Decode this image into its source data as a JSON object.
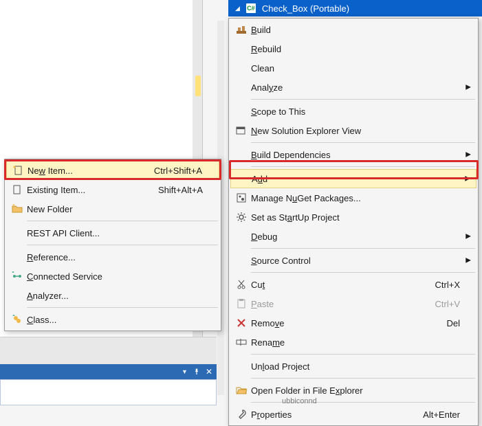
{
  "project": {
    "name": "Check_Box (Portable)"
  },
  "main_menu": {
    "build": {
      "label": "Build",
      "u": 0
    },
    "rebuild": {
      "label": "Rebuild",
      "u": 0
    },
    "clean": {
      "label": "Clean",
      "u": -1
    },
    "analyze": {
      "label": "Analyze",
      "u": 4
    },
    "scope": {
      "label": "Scope to This",
      "u": 0
    },
    "new_view": {
      "label": "New Solution Explorer View",
      "u": 0
    },
    "build_deps": {
      "label": "Build Dependencies",
      "u": 0
    },
    "add": {
      "label": "Add",
      "u": 1
    },
    "nuget": {
      "label": "Manage NuGet Packages...",
      "u": 8
    },
    "startup": {
      "label": "Set as StartUp Project",
      "u": 10
    },
    "debug": {
      "label": "Debug",
      "u": 0
    },
    "source_control": {
      "label": "Source Control",
      "u": 0
    },
    "cut": {
      "label": "Cut",
      "u": 2,
      "shortcut": "Ctrl+X"
    },
    "paste": {
      "label": "Paste",
      "u": 0,
      "shortcut": "Ctrl+V"
    },
    "remove": {
      "label": "Remove",
      "u": 4,
      "shortcut": "Del"
    },
    "rename": {
      "label": "Rename",
      "u": 4
    },
    "unload": {
      "label": "Unload Project",
      "u": 2
    },
    "open_folder": {
      "label": "Open Folder in File Explorer",
      "u": 20
    },
    "properties": {
      "label": "Properties",
      "u": 1,
      "shortcut": "Alt+Enter"
    }
  },
  "sub_menu": {
    "new_item": {
      "label": "New Item...",
      "u": 2,
      "shortcut": "Ctrl+Shift+A"
    },
    "existing_item": {
      "label": "Existing Item...",
      "u": -1,
      "shortcut": "Shift+Alt+A"
    },
    "new_folder": {
      "label": "New Folder",
      "u": -1
    },
    "rest_client": {
      "label": "REST API Client...",
      "u": -1
    },
    "reference": {
      "label": "Reference...",
      "u": 0
    },
    "connected": {
      "label": "Connected Service",
      "u": 0
    },
    "analyzer": {
      "label": "Analyzer...",
      "u": 0
    },
    "class": {
      "label": "Class...",
      "u": 0
    }
  },
  "bottom_text": "ubbiconnd"
}
